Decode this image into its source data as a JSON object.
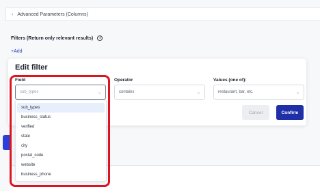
{
  "background": {
    "advanced_params_label": "Advanced Parameters (Columns)",
    "filters_label": "Filters (Return only relevant results)",
    "add_link": "+Add"
  },
  "modal": {
    "title": "Edit filter",
    "field": {
      "label": "Field",
      "placeholder": "sub_types"
    },
    "operator": {
      "label": "Operator",
      "value": "contains"
    },
    "values": {
      "label": "Values (one of):",
      "placeholder": "restaurant, bar, etc."
    },
    "cancel_label": "Cancel",
    "confirm_label": "Confirm"
  },
  "dropdown": {
    "options": [
      {
        "label": "sub_types",
        "selected": true
      },
      {
        "label": "business_status"
      },
      {
        "label": "verified"
      },
      {
        "label": "state"
      },
      {
        "label": "city"
      },
      {
        "label": "postal_code"
      },
      {
        "label": "website"
      },
      {
        "label": "business_phone"
      }
    ]
  },
  "colors": {
    "accent": "#1f2fa8",
    "highlight": "#e0121f",
    "selected_option_bg": "#e7eefc"
  }
}
